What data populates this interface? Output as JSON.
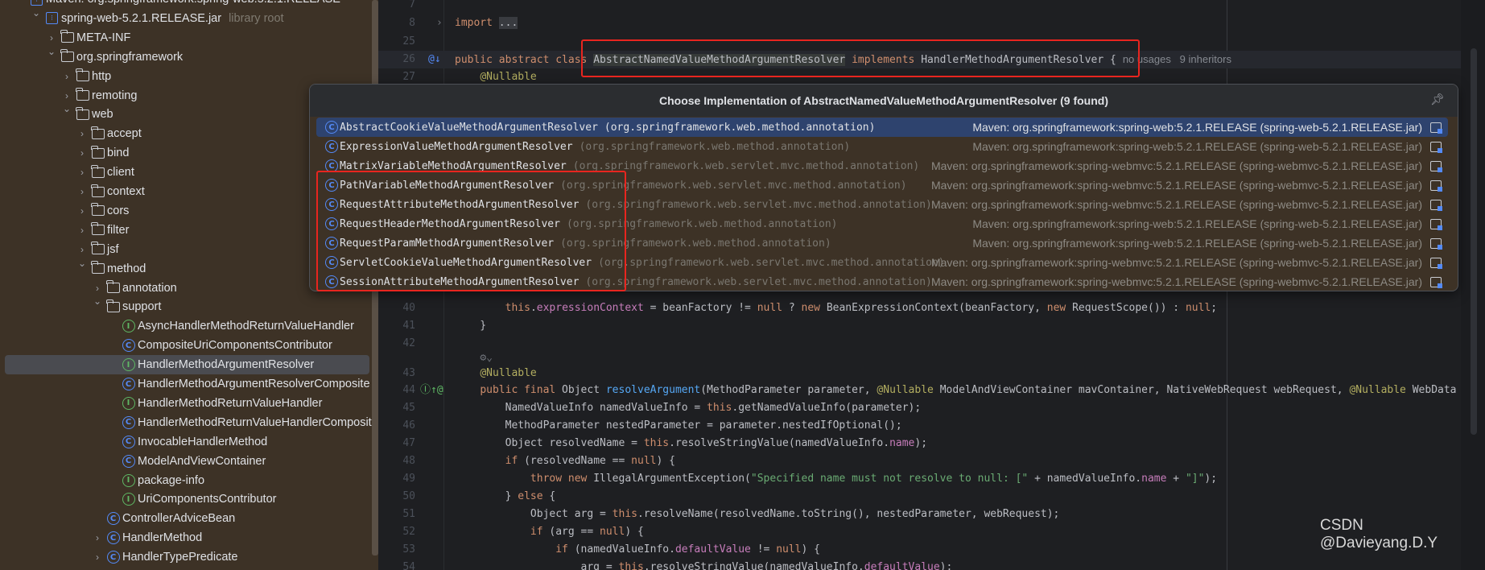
{
  "sidebar": {
    "items": [
      {
        "label": "Maven: org.springframework:spring-web:5.2.1.RELEASE",
        "level": -1,
        "arrow": "down",
        "icon": "library"
      },
      {
        "label": "spring-web-5.2.1.RELEASE.jar",
        "extra": "library root",
        "level": 0,
        "arrow": "down",
        "icon": "jar"
      },
      {
        "label": "META-INF",
        "level": 1,
        "arrow": "right",
        "icon": "folder"
      },
      {
        "label": "org.springframework",
        "level": 1,
        "arrow": "down",
        "icon": "folder"
      },
      {
        "label": "http",
        "level": 2,
        "arrow": "right",
        "icon": "folder"
      },
      {
        "label": "remoting",
        "level": 2,
        "arrow": "right",
        "icon": "folder"
      },
      {
        "label": "web",
        "level": 2,
        "arrow": "down",
        "icon": "folder"
      },
      {
        "label": "accept",
        "level": 3,
        "arrow": "right",
        "icon": "folder"
      },
      {
        "label": "bind",
        "level": 3,
        "arrow": "right",
        "icon": "folder"
      },
      {
        "label": "client",
        "level": 3,
        "arrow": "right",
        "icon": "folder"
      },
      {
        "label": "context",
        "level": 3,
        "arrow": "right",
        "icon": "folder"
      },
      {
        "label": "cors",
        "level": 3,
        "arrow": "right",
        "icon": "folder"
      },
      {
        "label": "filter",
        "level": 3,
        "arrow": "right",
        "icon": "folder"
      },
      {
        "label": "jsf",
        "level": 3,
        "arrow": "right",
        "icon": "folder"
      },
      {
        "label": "method",
        "level": 3,
        "arrow": "down",
        "icon": "folder"
      },
      {
        "label": "annotation",
        "level": 4,
        "arrow": "right",
        "icon": "folder"
      },
      {
        "label": "support",
        "level": 4,
        "arrow": "down",
        "icon": "folder"
      },
      {
        "label": "AsyncHandlerMethodReturnValueHandler",
        "level": 5,
        "arrow": "none",
        "icon": "interface"
      },
      {
        "label": "CompositeUriComponentsContributor",
        "level": 5,
        "arrow": "none",
        "icon": "class"
      },
      {
        "label": "HandlerMethodArgumentResolver",
        "level": 5,
        "arrow": "none",
        "icon": "interface",
        "selected": true
      },
      {
        "label": "HandlerMethodArgumentResolverComposite",
        "level": 5,
        "arrow": "none",
        "icon": "class"
      },
      {
        "label": "HandlerMethodReturnValueHandler",
        "level": 5,
        "arrow": "none",
        "icon": "interface"
      },
      {
        "label": "HandlerMethodReturnValueHandlerComposite",
        "level": 5,
        "arrow": "none",
        "icon": "class"
      },
      {
        "label": "InvocableHandlerMethod",
        "level": 5,
        "arrow": "none",
        "icon": "class"
      },
      {
        "label": "ModelAndViewContainer",
        "level": 5,
        "arrow": "none",
        "icon": "class"
      },
      {
        "label": "package-info",
        "level": 5,
        "arrow": "none",
        "icon": "interface"
      },
      {
        "label": "UriComponentsContributor",
        "level": 5,
        "arrow": "none",
        "icon": "interface"
      },
      {
        "label": "ControllerAdviceBean",
        "level": 4,
        "arrow": "none",
        "icon": "class"
      },
      {
        "label": "HandlerMethod",
        "level": 4,
        "arrow": "right",
        "icon": "class"
      },
      {
        "label": "HandlerTypePredicate",
        "level": 4,
        "arrow": "right",
        "icon": "class"
      }
    ]
  },
  "editor": {
    "lines": [
      {
        "n": "7",
        "tokens": []
      },
      {
        "n": "8",
        "fold": true,
        "tokens": [
          {
            "t": "import",
            "k": "kw"
          },
          {
            "t": " "
          },
          {
            "t": "...",
            "k": "fold"
          }
        ]
      },
      {
        "n": "25",
        "tokens": []
      },
      {
        "n": "26",
        "highlight": true,
        "gutter": "@↓",
        "tokens": [
          {
            "t": "public abstract class ",
            "k": "kw"
          },
          {
            "t": "AbstractNamedValueMethodArgumentResolver",
            "k": "sel"
          },
          {
            "t": " "
          },
          {
            "t": "implements",
            "k": "kw"
          },
          {
            "t": " HandlerMethodArgumentResolver {"
          }
        ],
        "inlay": "no usages   9 inheritors"
      },
      {
        "n": "27",
        "tokens": [
          {
            "t": "    "
          },
          {
            "t": "@Nullable",
            "k": "an"
          }
        ]
      },
      {
        "n": "40",
        "tokens": [
          {
            "t": "        "
          },
          {
            "t": "this",
            "k": "kw"
          },
          {
            "t": "."
          },
          {
            "t": "expressionContext",
            "k": "fd"
          },
          {
            "t": " = beanFactory != "
          },
          {
            "t": "null",
            "k": "kw"
          },
          {
            "t": " ? "
          },
          {
            "t": "new",
            "k": "kw"
          },
          {
            "t": " BeanExpressionContext(beanFactory, "
          },
          {
            "t": "new",
            "k": "kw"
          },
          {
            "t": " RequestScope()) : "
          },
          {
            "t": "null",
            "k": "kw"
          },
          {
            "t": ";"
          }
        ]
      },
      {
        "n": "41",
        "tokens": [
          {
            "t": "    }"
          }
        ]
      },
      {
        "n": "42",
        "tokens": []
      },
      {
        "n": "",
        "tokens": [
          {
            "t": "    "
          },
          {
            "t": "⚙⌄",
            "k": "dim"
          }
        ]
      },
      {
        "n": "43",
        "tokens": [
          {
            "t": "    "
          },
          {
            "t": "@Nullable",
            "k": "an"
          }
        ]
      },
      {
        "n": "44",
        "gutter": "Ⓘ↑@",
        "tokens": [
          {
            "t": "    "
          },
          {
            "t": "public final",
            "k": "kw"
          },
          {
            "t": " Object "
          },
          {
            "t": "resolveArgument",
            "k": "fn"
          },
          {
            "t": "(MethodParameter parameter, "
          },
          {
            "t": "@Nullable",
            "k": "an"
          },
          {
            "t": " ModelAndViewContainer mavContainer, NativeWebRequest webRequest, "
          },
          {
            "t": "@Nullable",
            "k": "an"
          },
          {
            "t": " WebData"
          }
        ]
      },
      {
        "n": "45",
        "tokens": [
          {
            "t": "        NamedValueInfo namedValueInfo = "
          },
          {
            "t": "this",
            "k": "kw"
          },
          {
            "t": ".getNamedValueInfo(parameter);"
          }
        ]
      },
      {
        "n": "46",
        "tokens": [
          {
            "t": "        MethodParameter nestedParameter = parameter.nestedIfOptional();"
          }
        ]
      },
      {
        "n": "47",
        "tokens": [
          {
            "t": "        Object resolvedName = "
          },
          {
            "t": "this",
            "k": "kw"
          },
          {
            "t": ".resolveStringValue(namedValueInfo."
          },
          {
            "t": "name",
            "k": "fd"
          },
          {
            "t": ");"
          }
        ]
      },
      {
        "n": "48",
        "tokens": [
          {
            "t": "        "
          },
          {
            "t": "if",
            "k": "kw"
          },
          {
            "t": " (resolvedName == "
          },
          {
            "t": "null",
            "k": "kw"
          },
          {
            "t": ") {"
          }
        ]
      },
      {
        "n": "49",
        "tokens": [
          {
            "t": "            "
          },
          {
            "t": "throw new",
            "k": "kw"
          },
          {
            "t": " IllegalArgumentException("
          },
          {
            "t": "\"Specified name must not resolve to null: [\"",
            "k": "str"
          },
          {
            "t": " + namedValueInfo."
          },
          {
            "t": "name",
            "k": "fd"
          },
          {
            "t": " + "
          },
          {
            "t": "\"]\"",
            "k": "str"
          },
          {
            "t": ");"
          }
        ]
      },
      {
        "n": "50",
        "tokens": [
          {
            "t": "        } "
          },
          {
            "t": "else",
            "k": "kw"
          },
          {
            "t": " {"
          }
        ]
      },
      {
        "n": "51",
        "tokens": [
          {
            "t": "            Object arg = "
          },
          {
            "t": "this",
            "k": "kw"
          },
          {
            "t": ".resolveName(resolvedName.toString(), nestedParameter, webRequest);"
          }
        ]
      },
      {
        "n": "52",
        "tokens": [
          {
            "t": "            "
          },
          {
            "t": "if",
            "k": "kw"
          },
          {
            "t": " (arg == "
          },
          {
            "t": "null",
            "k": "kw"
          },
          {
            "t": ") {"
          }
        ]
      },
      {
        "n": "53",
        "tokens": [
          {
            "t": "                "
          },
          {
            "t": "if",
            "k": "kw"
          },
          {
            "t": " (namedValueInfo."
          },
          {
            "t": "defaultValue",
            "k": "fd"
          },
          {
            "t": " != "
          },
          {
            "t": "null",
            "k": "kw"
          },
          {
            "t": ") {"
          }
        ]
      },
      {
        "n": "54",
        "tokens": [
          {
            "t": "                    arg = "
          },
          {
            "t": "this",
            "k": "kw"
          },
          {
            "t": ".resolveStringValue(namedValueInfo."
          },
          {
            "t": "defaultValue",
            "k": "fd"
          },
          {
            "t": ");"
          }
        ]
      }
    ]
  },
  "popup": {
    "title": "Choose Implementation of AbstractNamedValueMethodArgumentResolver (9 found)",
    "pin_icon": "pin-icon",
    "items": [
      {
        "name": "AbstractCookieValueMethodArgumentResolver",
        "package": "(org.springframework.web.method.annotation)",
        "library": "Maven: org.springframework:spring-web:5.2.1.RELEASE (spring-web-5.2.1.RELEASE.jar)",
        "selected": true
      },
      {
        "name": "ExpressionValueMethodArgumentResolver",
        "package": "(org.springframework.web.method.annotation)",
        "library": "Maven: org.springframework:spring-web:5.2.1.RELEASE (spring-web-5.2.1.RELEASE.jar)"
      },
      {
        "name": "MatrixVariableMethodArgumentResolver",
        "package": "(org.springframework.web.servlet.mvc.method.annotation)",
        "library": "Maven: org.springframework:spring-webmvc:5.2.1.RELEASE (spring-webmvc-5.2.1.RELEASE.jar)"
      },
      {
        "name": "PathVariableMethodArgumentResolver",
        "package": "(org.springframework.web.servlet.mvc.method.annotation)",
        "library": "Maven: org.springframework:spring-webmvc:5.2.1.RELEASE (spring-webmvc-5.2.1.RELEASE.jar)"
      },
      {
        "name": "RequestAttributeMethodArgumentResolver",
        "package": "(org.springframework.web.servlet.mvc.method.annotation)",
        "library": "Maven: org.springframework:spring-webmvc:5.2.1.RELEASE (spring-webmvc-5.2.1.RELEASE.jar)"
      },
      {
        "name": "RequestHeaderMethodArgumentResolver",
        "package": "(org.springframework.web.method.annotation)",
        "library": "Maven: org.springframework:spring-web:5.2.1.RELEASE (spring-web-5.2.1.RELEASE.jar)"
      },
      {
        "name": "RequestParamMethodArgumentResolver",
        "package": "(org.springframework.web.method.annotation)",
        "library": "Maven: org.springframework:spring-web:5.2.1.RELEASE (spring-web-5.2.1.RELEASE.jar)"
      },
      {
        "name": "ServletCookieValueMethodArgumentResolver",
        "package": "(org.springframework.web.servlet.mvc.method.annotation)",
        "library": "Maven: org.springframework:spring-webmvc:5.2.1.RELEASE (spring-webmvc-5.2.1.RELEASE.jar)"
      },
      {
        "name": "SessionAttributeMethodArgumentResolver",
        "package": "(org.springframework.web.servlet.mvc.method.annotation)",
        "library": "Maven: org.springframework:spring-webmvc:5.2.1.RELEASE (spring-webmvc-5.2.1.RELEASE.jar)"
      }
    ]
  },
  "watermark": "CSDN @Davieyang.D.Y",
  "colors": {
    "annotation_box": "#e8251f",
    "selection": "#2e436e",
    "panel": "#3d3226"
  }
}
